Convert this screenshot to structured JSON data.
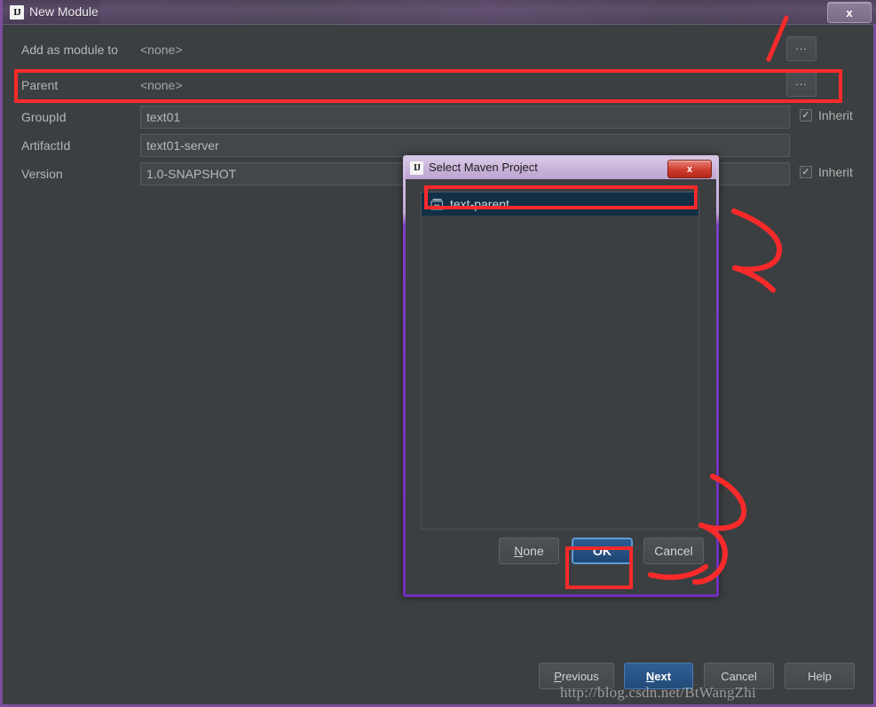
{
  "outer_dialog": {
    "title": "New Module",
    "title_icon": "intellij-idea-icon",
    "close_label": "x",
    "fields": [
      {
        "label": "Add as module to",
        "type": "static",
        "value": "<none>",
        "has_browse": true,
        "browse_label": "...",
        "inherit": null
      },
      {
        "label": "Parent",
        "type": "static",
        "value": "<none>",
        "has_browse": true,
        "browse_label": "...",
        "inherit": null
      },
      {
        "label": "GroupId",
        "type": "input",
        "value": "text01",
        "has_browse": false,
        "inherit": "Inherit"
      },
      {
        "label": "ArtifactId",
        "type": "input",
        "value": "text01-server",
        "has_browse": false,
        "inherit": null
      },
      {
        "label": "Version",
        "type": "input",
        "value": "1.0-SNAPSHOT",
        "has_browse": false,
        "inherit": "Inherit"
      }
    ],
    "buttons": [
      {
        "label": "Previous",
        "mnemonic": "P",
        "primary": false
      },
      {
        "label": "Next",
        "mnemonic": "N",
        "primary": true
      },
      {
        "label": "Cancel",
        "mnemonic": "",
        "primary": false
      },
      {
        "label": "Help",
        "mnemonic": "",
        "primary": false
      }
    ]
  },
  "inner_dialog": {
    "title": "Select Maven Project",
    "title_icon": "intellij-idea-icon",
    "close_label": "x",
    "list": [
      {
        "label": "text-parent",
        "icon": "maven-project-icon",
        "selected": true
      }
    ],
    "buttons": [
      {
        "label": "None",
        "mnemonic": "N",
        "primary": false
      },
      {
        "label": "OK",
        "mnemonic": "",
        "primary": true
      },
      {
        "label": "Cancel",
        "mnemonic": "",
        "primary": false
      }
    ]
  },
  "watermark": {
    "text": "http://blog.csdn.net/BtWangZhi"
  },
  "annotations": {
    "color": "#fa2a2a",
    "marks": [
      {
        "name": "parent-row-highlight",
        "kind": "box"
      },
      {
        "name": "maven-project-item-highlight",
        "kind": "box"
      },
      {
        "name": "ok-button-highlight",
        "kind": "box"
      },
      {
        "name": "browse-button-pointer-stroke",
        "kind": "stroke"
      },
      {
        "name": "step-2-mark",
        "kind": "stroke"
      },
      {
        "name": "step-3-mark",
        "kind": "stroke"
      },
      {
        "name": "cancel-underline-stroke",
        "kind": "stroke"
      }
    ]
  }
}
